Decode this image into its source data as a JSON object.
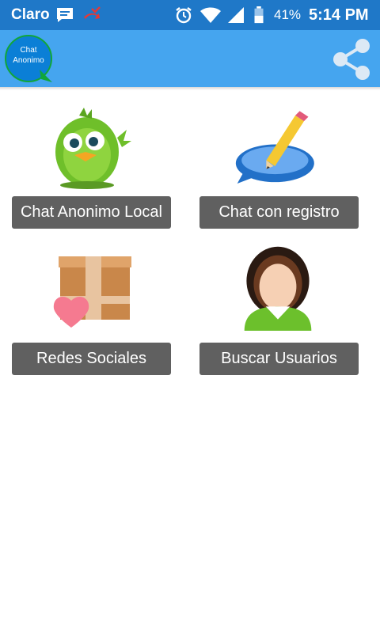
{
  "status_bar": {
    "carrier": "Claro",
    "battery_percent": "41%",
    "time": "5:14 PM",
    "icons": [
      "chat-notification-icon",
      "missed-call-icon",
      "alarm-icon",
      "wifi-icon",
      "signal-icon",
      "battery-icon"
    ]
  },
  "app_bar": {
    "logo_text_line1": "Chat",
    "logo_text_line2": "Anonimo",
    "share_icon": "share-icon",
    "color": "#45a5ef"
  },
  "menu": {
    "items": [
      {
        "label": "Chat Anonimo Local",
        "icon": "bird-icon"
      },
      {
        "label": "Chat con registro",
        "icon": "pencil-speech-icon"
      },
      {
        "label": "Redes Sociales",
        "icon": "box-heart-icon"
      },
      {
        "label": "Buscar Usuarios",
        "icon": "user-avatar-icon"
      }
    ]
  }
}
